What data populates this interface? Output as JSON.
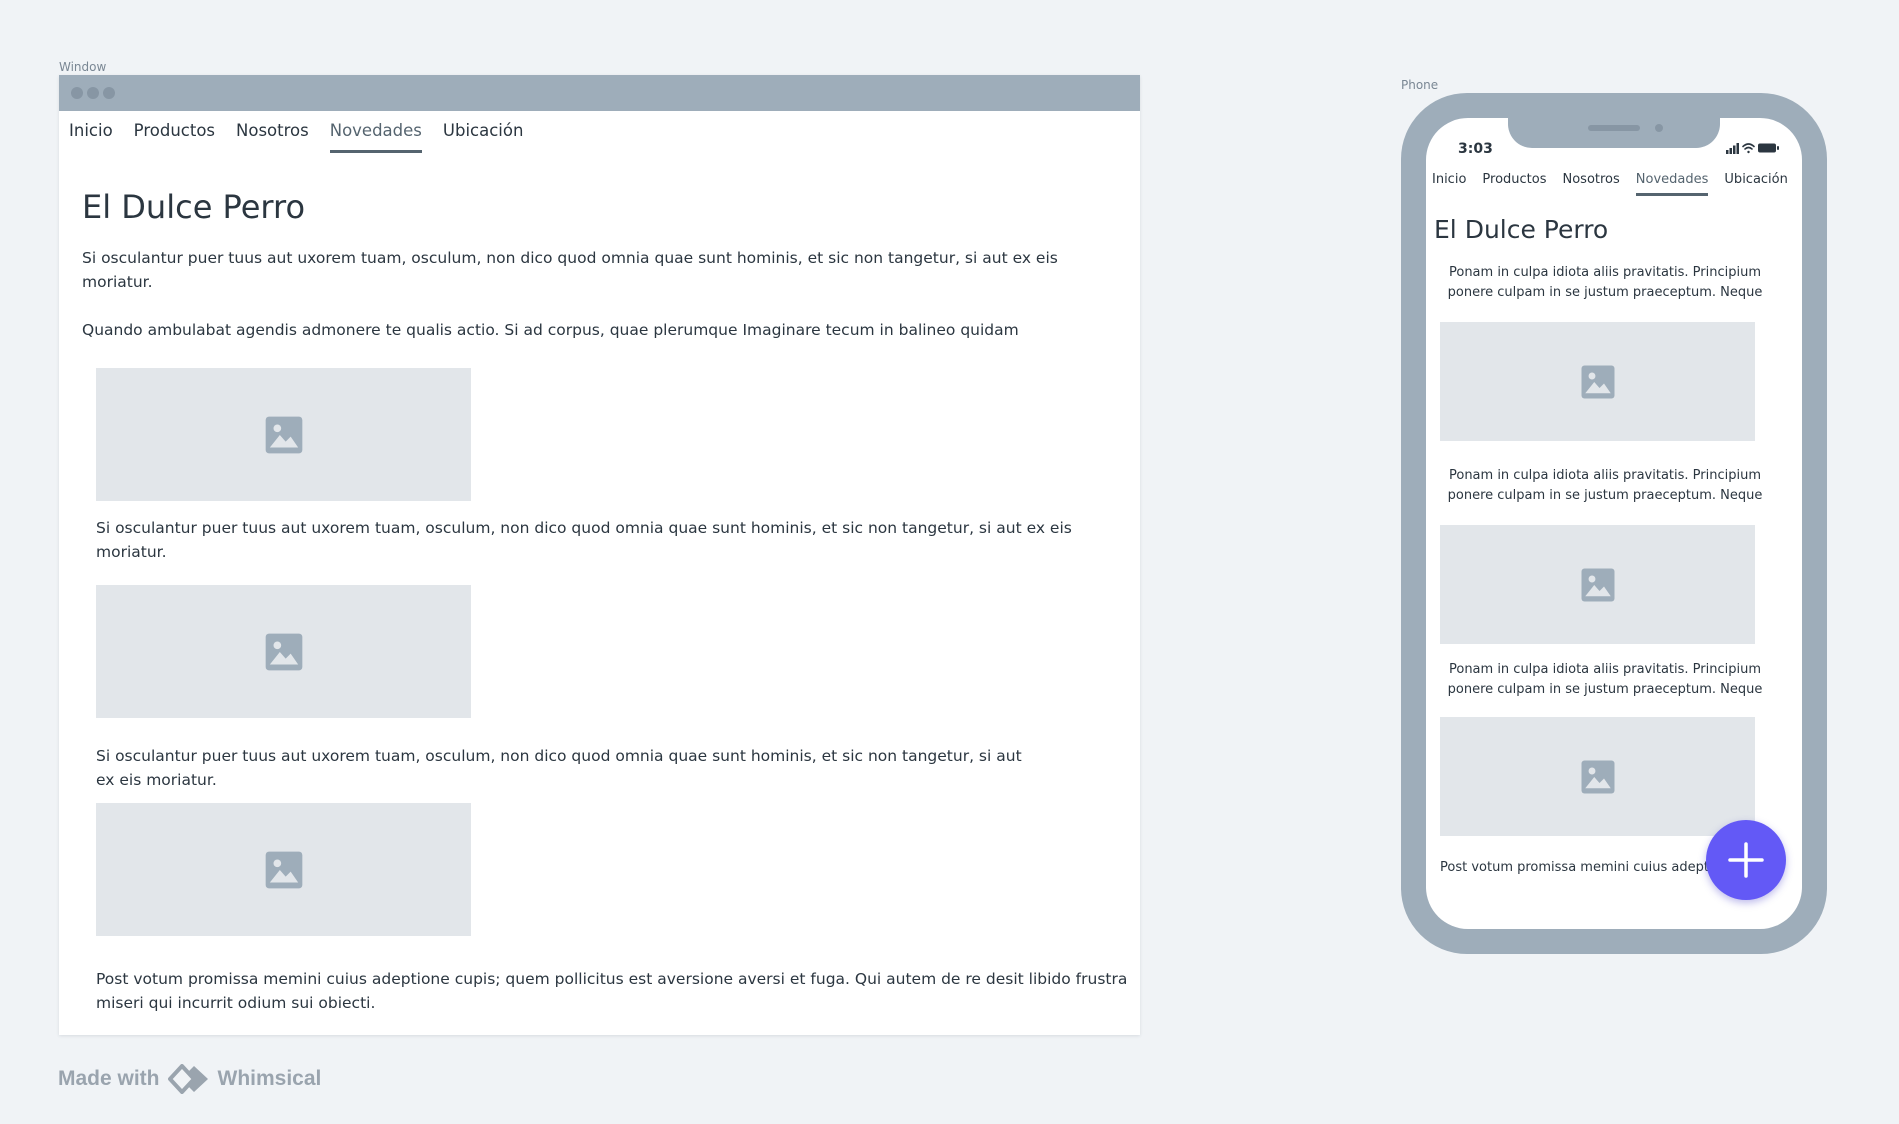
{
  "window": {
    "frame_label": "Window",
    "nav": [
      {
        "label": "Inicio"
      },
      {
        "label": "Productos"
      },
      {
        "label": "Nosotros"
      },
      {
        "label": "Novedades",
        "active": true
      },
      {
        "label": "Ubicación"
      }
    ],
    "title": "El Dulce Perro",
    "intro_1": "Si osculantur puer tuus aut uxorem tuam, osculum, non dico quod omnia quae sunt hominis, et sic non tangetur, si aut ex eis moriatur.",
    "intro_2": "Quando ambulabat agendis admonere te qualis actio. Si ad corpus, quae plerumque Imaginare tecum in balineo quidam",
    "caption_1": "Si osculantur puer tuus aut uxorem tuam, osculum, non dico quod omnia quae sunt hominis, et sic non tangetur, si aut ex eis moriatur.",
    "caption_2a": "Si osculantur puer tuus aut uxorem tuam, osculum, non dico quod omnia quae sunt hominis, et sic non tangetur, si aut",
    "caption_2b": "ex eis moriatur.",
    "closing": "Post votum promissa memini cuius adeptione cupis; quem pollicitus est aversione aversi et fuga. Qui autem de re desit libido frustra miseri qui incurrit odium sui obiecti."
  },
  "phone": {
    "frame_label": "Phone",
    "time": "3:03",
    "nav": [
      {
        "label": "Inicio"
      },
      {
        "label": "Productos"
      },
      {
        "label": "Nosotros"
      },
      {
        "label": "Novedades",
        "active": true
      },
      {
        "label": "Ubicación"
      }
    ],
    "title": "El Dulce Perro",
    "paragraph": "Ponam in culpa idiota aliis pravitatis. Principium ponere culpam in se justum praeceptum. Neque",
    "closing": "Post votum promissa memini cuius adeptione"
  },
  "footer": {
    "made_with": "Made with",
    "brand": "Whimsical"
  },
  "colors": {
    "frame": "#9eadba",
    "placeholder": "#e2e6ea",
    "placeholder_icon": "#9eadba",
    "accent": "#6359f6",
    "text": "#2b3640"
  },
  "icons": {
    "image_placeholder": "image-icon",
    "fab": "plus-icon",
    "status": [
      "signal-icon",
      "wifi-icon",
      "battery-icon"
    ],
    "logo": "whimsical-logo-icon"
  }
}
